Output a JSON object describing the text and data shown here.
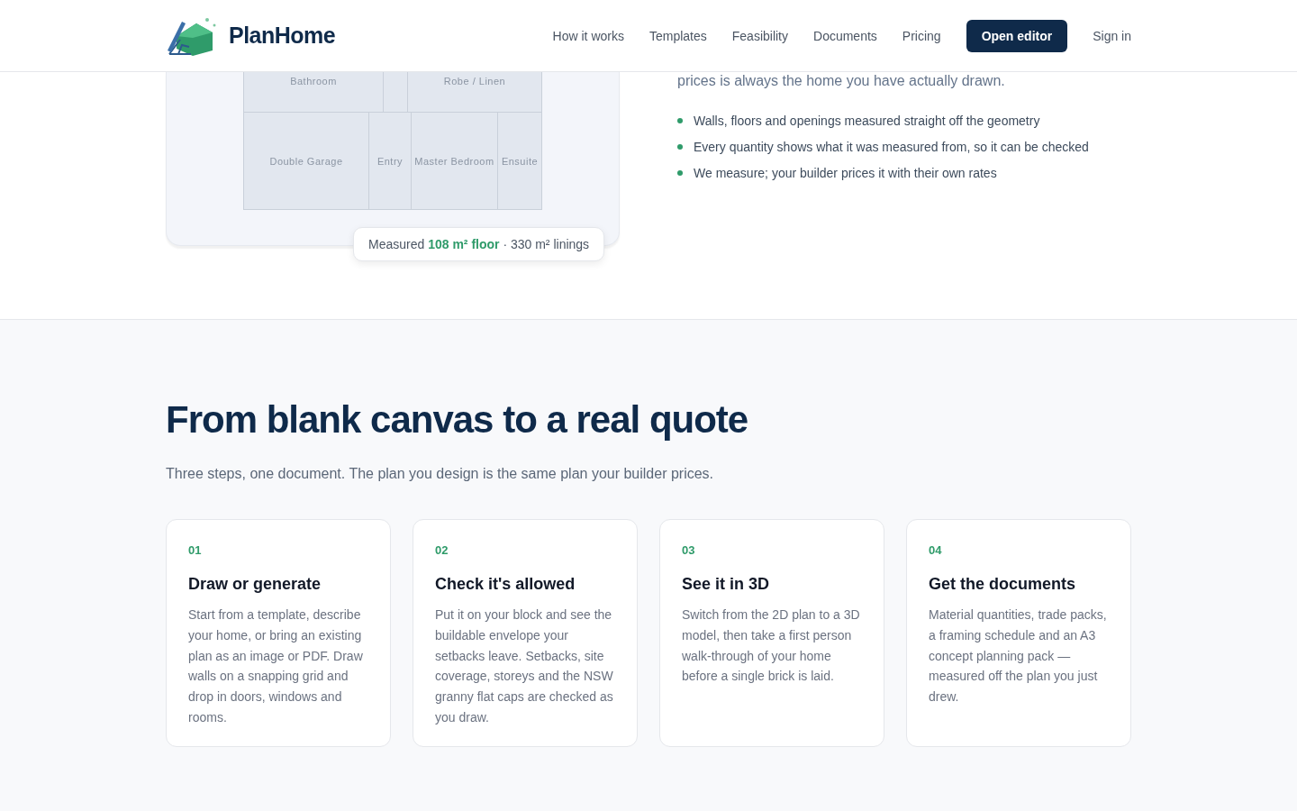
{
  "header": {
    "brand": "PlanHome",
    "nav": [
      {
        "label": "How it works"
      },
      {
        "label": "Templates"
      },
      {
        "label": "Feasibility"
      },
      {
        "label": "Documents"
      },
      {
        "label": "Pricing"
      }
    ],
    "cta": "Open editor",
    "sign_in": "Sign in"
  },
  "plan": {
    "rows": [
      [
        "Bathroom",
        "",
        "Robe / Linen"
      ],
      [
        "Double Garage",
        "Entry",
        "Master Bedroom",
        "Ensuite"
      ]
    ],
    "badge": "Measured **108 m² floor** · 330 m² linings"
  },
  "intro": {
    "text": "prices is always the home you have actually drawn.",
    "bullets": [
      "Walls, floors and openings measured straight off the geometry",
      "Every quantity shows what it was measured from, so it can be checked",
      "We measure; your builder prices it with their own rates"
    ]
  },
  "steps_section": {
    "title": "From blank canvas to a real quote",
    "subtitle": "Three steps, one document. The plan you design is the same plan your builder prices.",
    "steps": [
      {
        "number": "01",
        "title": "Draw or generate",
        "text": "Start from a template, describe your home, or bring an existing plan as an image or PDF. Draw walls on a snapping grid and drop in doors, windows and rooms."
      },
      {
        "number": "02",
        "title": "Check it's allowed",
        "text": "Put it on your block and see the buildable envelope your setbacks leave. Setbacks, site coverage, storeys and the NSW granny flat caps are checked as you draw."
      },
      {
        "number": "03",
        "title": "See it in 3D",
        "text": "Switch from the 2D plan to a 3D model, then take a first person walk-through of your home before a single brick is laid."
      },
      {
        "number": "04",
        "title": "Get the documents",
        "text": "Material quantities, trade packs, a framing schedule and an A3 concept planning pack — measured off the plan you just drew."
      }
    ]
  }
}
